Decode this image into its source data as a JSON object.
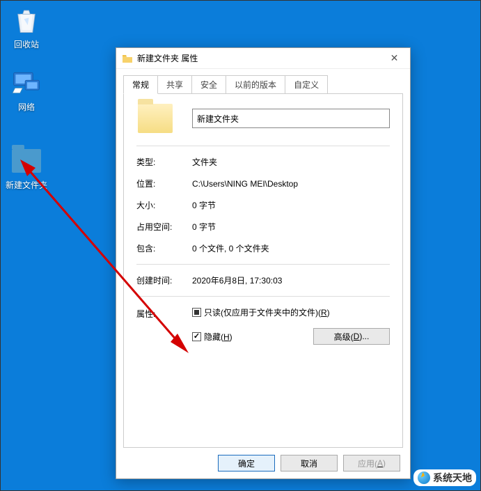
{
  "desktop": {
    "recycle_label": "回收站",
    "network_label": "网络",
    "folder_label": "新建文件夹"
  },
  "dialog": {
    "title": "新建文件夹 属性",
    "tabs": {
      "general": "常规",
      "sharing": "共享",
      "security": "安全",
      "previous": "以前的版本",
      "custom": "自定义"
    },
    "folder_name": "新建文件夹",
    "fields": {
      "type_k": "类型:",
      "type_v": "文件夹",
      "location_k": "位置:",
      "location_v": "C:\\Users\\NING MEI\\Desktop",
      "size_k": "大小:",
      "size_v": "0 字节",
      "ondisk_k": "占用空间:",
      "ondisk_v": "0 字节",
      "contains_k": "包含:",
      "contains_v": "0 个文件, 0 个文件夹",
      "created_k": "创建时间:",
      "created_v": "2020年6月8日, 17:30:03",
      "attr_k": "属性:"
    },
    "readonly_label_pre": "只读(仅应用于文件夹中的文件)(",
    "readonly_key": "R",
    "readonly_label_post": ")",
    "hidden_label_pre": "隐藏(",
    "hidden_key": "H",
    "hidden_label_post": ")",
    "advanced_pre": "高级(",
    "advanced_key": "D",
    "advanced_post": ")...",
    "ok": "确定",
    "cancel": "取消",
    "apply_pre": "应用(",
    "apply_key": "A",
    "apply_post": ")"
  },
  "watermark": "系统天地"
}
